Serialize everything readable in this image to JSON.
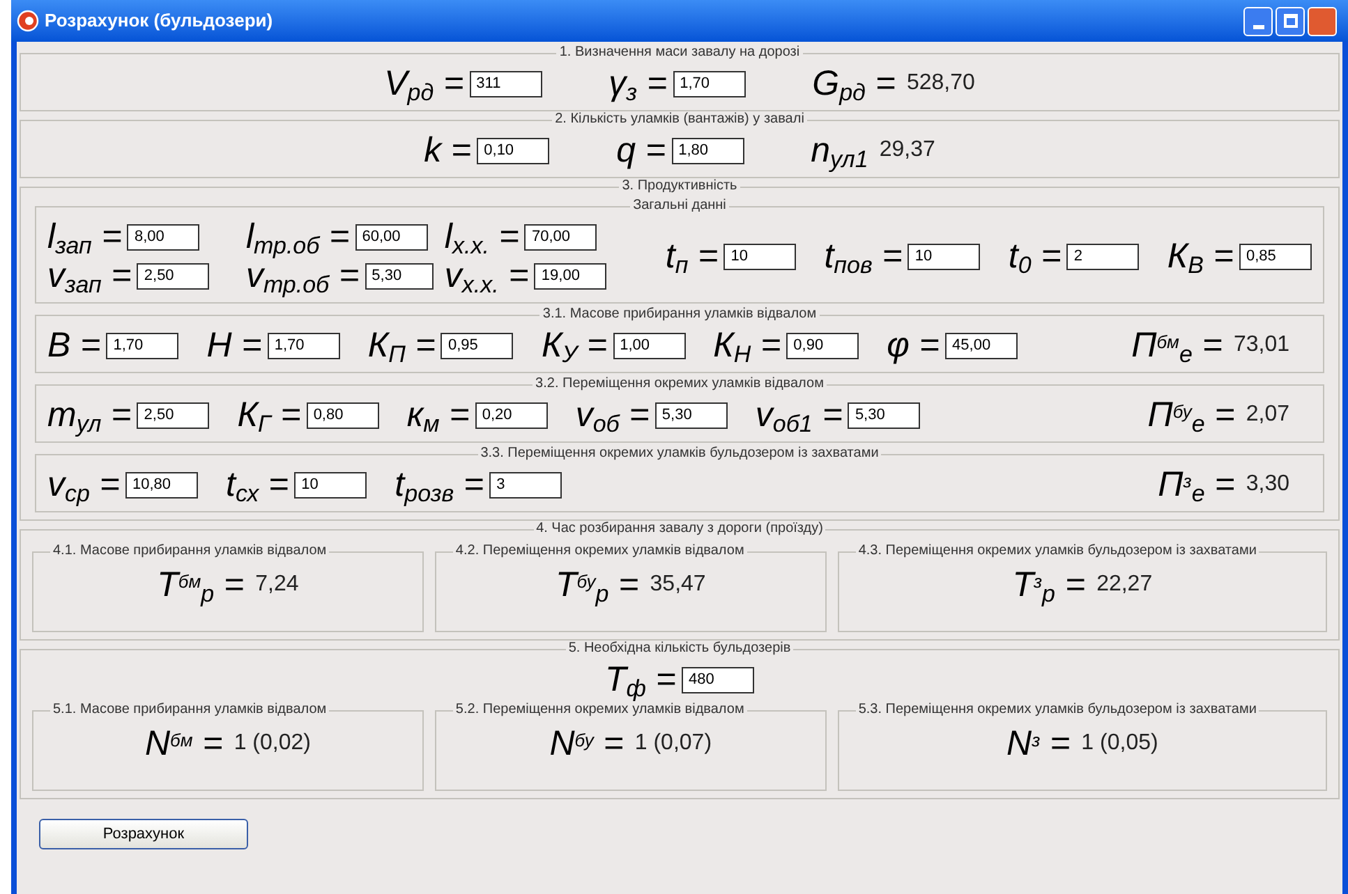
{
  "window": {
    "title": "Розрахунок (бульдозери)"
  },
  "sections": [
    {
      "title": "1. Визначення маси завалу на дорозі",
      "items": [
        {
          "kind": "input",
          "label": "V$_{рд}$ =",
          "value": "311"
        },
        {
          "kind": "input",
          "label": "γ$_{з}$ =",
          "value": "1,70"
        },
        {
          "kind": "output",
          "label": "G$_{рд}$ =",
          "value": "528,70"
        }
      ]
    },
    {
      "title": "2. Кількість уламків (вантажів) у завалі",
      "items": [
        {
          "kind": "input",
          "label": "k =",
          "value": "0,10"
        },
        {
          "kind": "input",
          "label": "q =",
          "value": "1,80"
        },
        {
          "kind": "output",
          "label": "n$_{ул1}$",
          "value": "29,37"
        }
      ]
    },
    {
      "title": "3. Продуктивність",
      "subsections": [
        {
          "title": "Загальні данні",
          "grid": [
            {
              "kind": "input",
              "label": "l$_{зап}$ =",
              "value": "8,00"
            },
            {
              "kind": "input",
              "label": "l$_{тр.об}$ =",
              "value": "60,00"
            },
            {
              "kind": "input",
              "label": "l$_{х.х.}$ =",
              "value": "70,00"
            },
            {
              "kind": "input",
              "label": "v$_{зап}$ =",
              "value": "2,50"
            },
            {
              "kind": "input",
              "label": "v$_{тр.об}$ =",
              "value": "5,30"
            },
            {
              "kind": "input",
              "label": "v$_{х.х.}$ =",
              "value": "19,00"
            }
          ],
          "items": [
            {
              "kind": "input",
              "label": "t$_{п}$ =",
              "value": "10"
            },
            {
              "kind": "input",
              "label": "t$_{пов}$ =",
              "value": "10"
            },
            {
              "kind": "input",
              "label": "t$_{0}$ =",
              "value": "2"
            },
            {
              "kind": "input",
              "label": "К$_{В}$ =",
              "value": "0,85"
            }
          ]
        },
        {
          "title": "3.1. Масове прибирання уламків відвалом",
          "items": [
            {
              "kind": "input",
              "label": "B =",
              "value": "1,70"
            },
            {
              "kind": "input",
              "label": "H =",
              "value": "1,70"
            },
            {
              "kind": "input",
              "label": "К$_{П}$ =",
              "value": "0,95"
            },
            {
              "kind": "input",
              "label": "К$_{У}$ =",
              "value": "1,00"
            },
            {
              "kind": "input",
              "label": "К$_{Н}$ =",
              "value": "0,90"
            },
            {
              "kind": "input",
              "label": "φ =",
              "value": "45,00"
            }
          ],
          "result": {
            "kind": "output",
            "label": "П$^{бм}$$_{е}$ =",
            "value": "73,01"
          }
        },
        {
          "title": "3.2. Переміщення окремих уламків відвалом",
          "items": [
            {
              "kind": "input",
              "label": "m$_{ул}$ =",
              "value": "2,50"
            },
            {
              "kind": "input",
              "label": "К$_{Г}$ =",
              "value": "0,80"
            },
            {
              "kind": "input",
              "label": "к$_{м}$ =",
              "value": "0,20"
            },
            {
              "kind": "input",
              "label": "v$_{об}$ =",
              "value": "5,30"
            },
            {
              "kind": "input",
              "label": "v$_{об1}$ =",
              "value": "5,30"
            }
          ],
          "result": {
            "kind": "output",
            "label": "П$^{бу}$$_{е}$ =",
            "value": "2,07"
          }
        },
        {
          "title": "3.3. Переміщення окремих уламків бульдозером із захватами",
          "items": [
            {
              "kind": "input",
              "label": "v$_{ср}$ =",
              "value": "10,80"
            },
            {
              "kind": "input",
              "label": "t$_{сх}$ =",
              "value": "10"
            },
            {
              "kind": "input",
              "label": "t$_{розв}$ =",
              "value": "3"
            }
          ],
          "result": {
            "kind": "output",
            "label": "П$^{з}$$_{е}$ =",
            "value": "3,30"
          }
        }
      ]
    },
    {
      "title": "4. Час розбирання завалу з дороги (проїзду)",
      "boxes": [
        {
          "title": "4.1. Масове прибирання уламків відвалом",
          "item": {
            "kind": "output",
            "label": "T$^{бм}$$_{р}$ =",
            "value": "7,24"
          }
        },
        {
          "title": "4.2. Переміщення окремих уламків відвалом",
          "item": {
            "kind": "output",
            "label": "T$^{бу}$$_{р}$ =",
            "value": "35,47"
          }
        },
        {
          "title": "4.3. Переміщення окремих уламків бульдозером із захватами",
          "item": {
            "kind": "output",
            "label": "T$^{з}$$_{р}$ =",
            "value": "22,27"
          }
        }
      ]
    },
    {
      "title": "5. Необхідна кількість бульдозерів",
      "items": [
        {
          "kind": "input",
          "label": "T$_{ф}$ =",
          "value": "480"
        }
      ],
      "boxes": [
        {
          "title": "5.1. Масове прибирання уламків відвалом",
          "item": {
            "kind": "output",
            "label": "N$^{бм}$ =",
            "value": "1 (0,02)"
          }
        },
        {
          "title": "5.2. Переміщення окремих уламків відвалом",
          "item": {
            "kind": "output",
            "label": "N$^{бу}$ =",
            "value": "1 (0,07)"
          }
        },
        {
          "title": "5.3. Переміщення окремих уламків бульдозером із захватами",
          "item": {
            "kind": "output",
            "label": "N$^{з}$ =",
            "value": "1 (0,05)"
          }
        }
      ]
    }
  ],
  "button": "Розрахунок"
}
